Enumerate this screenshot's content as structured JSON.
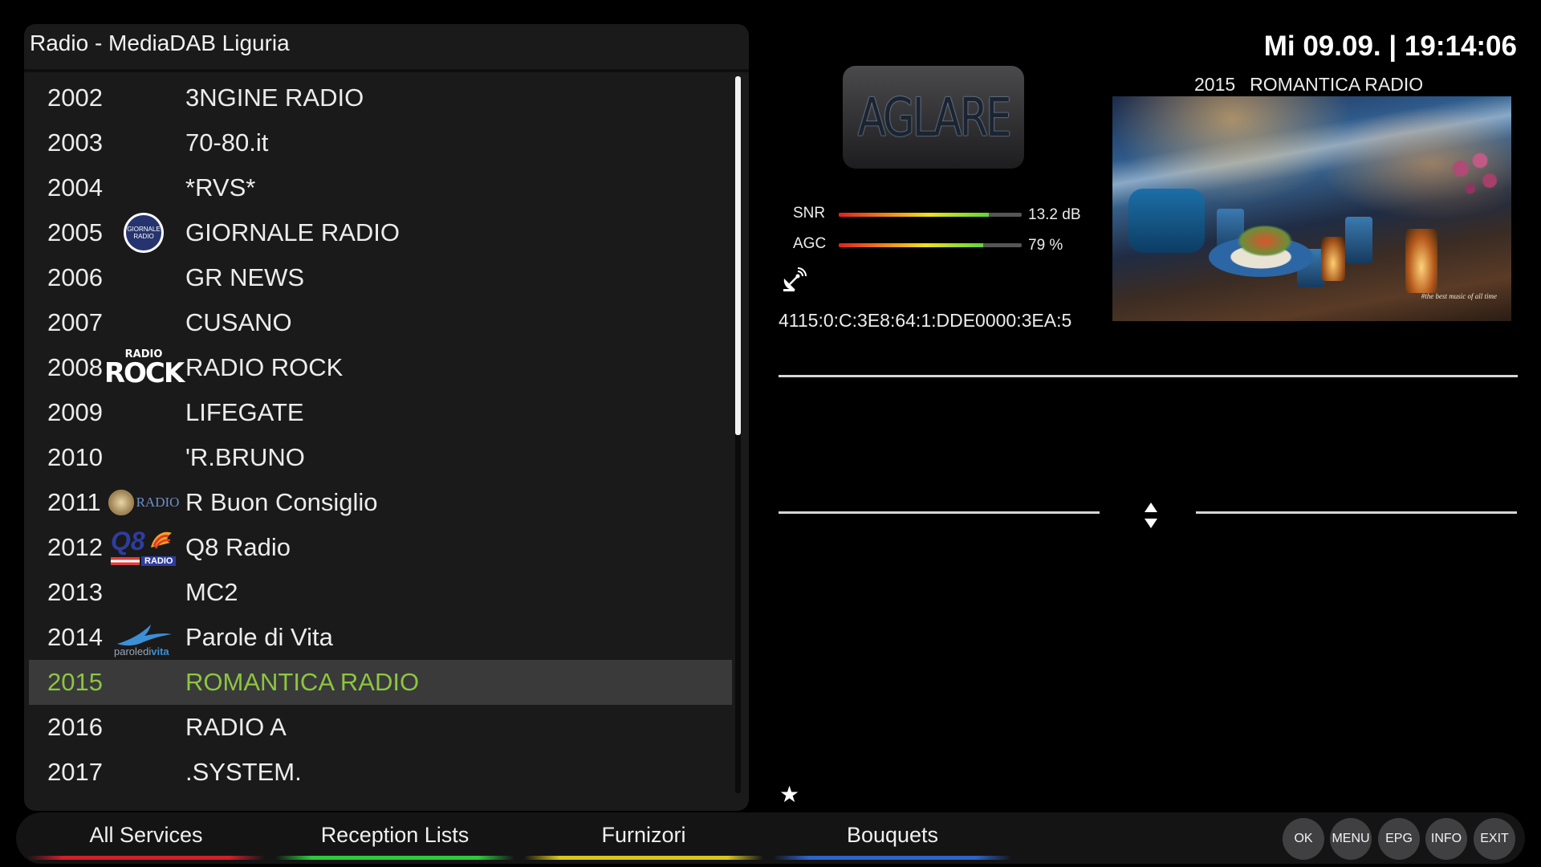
{
  "channel_list": {
    "title": "Radio - MediaDAB Liguria",
    "scroll_position": 0.5,
    "rows": [
      {
        "number": "2002",
        "name": "3NGINE RADIO",
        "logo": ""
      },
      {
        "number": "2003",
        "name": "70-80.it",
        "logo": ""
      },
      {
        "number": "2004",
        "name": "*RVS*",
        "logo": ""
      },
      {
        "number": "2005",
        "name": "GIORNALE RADIO",
        "logo": "giornale-radio-logo",
        "logo_text": "GIORNALE RADIO"
      },
      {
        "number": "2006",
        "name": "GR NEWS",
        "logo": ""
      },
      {
        "number": "2007",
        "name": "CUSANO",
        "logo": ""
      },
      {
        "number": "2008",
        "name": "RADIO ROCK",
        "logo": "radio-rock-logo",
        "logo_text_small": "RADIO",
        "logo_text_big": "ROCK"
      },
      {
        "number": "2009",
        "name": "LIFEGATE",
        "logo": ""
      },
      {
        "number": "2010",
        "name": "'R.BRUNO",
        "logo": ""
      },
      {
        "number": "2011",
        "name": "R Buon Consiglio",
        "logo": "radio-buon-consiglio-logo",
        "logo_text": "RADIO"
      },
      {
        "number": "2012",
        "name": "Q8 Radio",
        "logo": "q8-radio-logo",
        "logo_text_big": "Q8",
        "logo_text_small": "RADIO"
      },
      {
        "number": "2013",
        "name": "MC2",
        "logo": ""
      },
      {
        "number": "2014",
        "name": "Parole di Vita",
        "logo": "parole-di-vita-logo",
        "logo_text_a": "paroledi",
        "logo_text_b": "vita"
      },
      {
        "number": "2015",
        "name": "ROMANTICA RADIO",
        "logo": "",
        "selected": true
      },
      {
        "number": "2016",
        "name": "RADIO A",
        "logo": ""
      },
      {
        "number": "2017",
        "name": ".SYSTEM.",
        "logo": ""
      }
    ]
  },
  "header": {
    "clock": "Mi 09.09. | 19:14:06"
  },
  "info": {
    "skin_logo_text": "AGLARE",
    "snr_label": "SNR",
    "snr_value": "13.2 dB",
    "snr_level": 0.82,
    "agc_label": "AGC",
    "agc_value": "79 %",
    "agc_level": 0.79,
    "service_ref": "4115:0:C:3E8:64:1:DDE0000:3EA:5",
    "now_playing_number": "2015",
    "now_playing_name": "ROMANTICA RADIO",
    "cover_caption": "#the best music of all time"
  },
  "bottom_tabs": [
    {
      "label": "All Services",
      "color": "#d0202a"
    },
    {
      "label": "Reception Lists",
      "color": "#2ec83c"
    },
    {
      "label": "Furnizori",
      "color": "#d8c620"
    },
    {
      "label": "Bouquets",
      "color": "#2f63c8"
    }
  ],
  "keys": [
    "OK",
    "MENU",
    "EPG",
    "INFO",
    "EXIT"
  ],
  "colors": {
    "selected_text": "#8cc63f",
    "panel_bg": "#1a1a1b",
    "selected_row_bg": "#3a3a3b"
  }
}
